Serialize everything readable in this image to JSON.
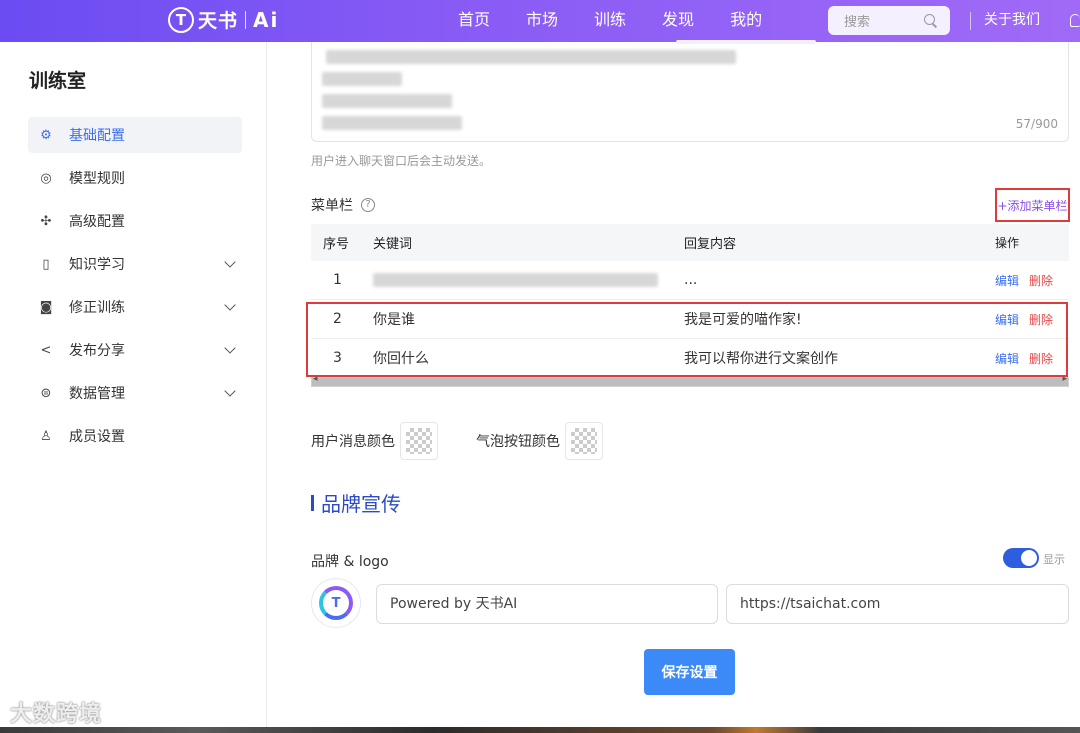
{
  "nav": {
    "logo_mark": "T",
    "logo_text": "天书",
    "logo_ai": "Ai",
    "items": [
      {
        "label": "首页"
      },
      {
        "label": "市场"
      },
      {
        "label": "训练"
      },
      {
        "label": "发现"
      },
      {
        "label": "我的"
      }
    ],
    "search_placeholder": "搜索",
    "about": "关于我们"
  },
  "sidebar": {
    "title": "训练室",
    "items": [
      {
        "label": "基础配置",
        "icon": "gear-icon",
        "active": true
      },
      {
        "label": "模型规则",
        "icon": "target-icon"
      },
      {
        "label": "高级配置",
        "icon": "puzzle-icon"
      },
      {
        "label": "知识学习",
        "icon": "book-icon",
        "expandable": true
      },
      {
        "label": "修正训练",
        "icon": "robot-icon",
        "expandable": true
      },
      {
        "label": "发布分享",
        "icon": "share-icon",
        "expandable": true
      },
      {
        "label": "数据管理",
        "icon": "list-icon",
        "expandable": true
      },
      {
        "label": "成员设置",
        "icon": "user-icon"
      }
    ]
  },
  "welcome": {
    "counter": "57/900",
    "hint": "用户进入聊天窗口后会主动发送。"
  },
  "menu_bar": {
    "title": "菜单栏",
    "add_label": "+添加菜单栏",
    "columns": [
      "序号",
      "关键词",
      "回复内容",
      "操作"
    ],
    "rows": [
      {
        "index": "1",
        "keyword": "",
        "reply": "...",
        "edit": "编辑",
        "delete": "删除"
      },
      {
        "index": "2",
        "keyword": "你是谁",
        "reply": "我是可爱的喵作家!",
        "edit": "编辑",
        "delete": "删除"
      },
      {
        "index": "3",
        "keyword": "你回什么",
        "reply": "我可以帮你进行文案创作",
        "edit": "编辑",
        "delete": "删除"
      }
    ]
  },
  "colors": {
    "user_msg_label": "用户消息颜色",
    "bubble_btn_label": "气泡按钮颜色"
  },
  "brand": {
    "section_title": "品牌宣传",
    "logo_label": "品牌 & logo",
    "toggle_label": "显示",
    "toggle_on": true,
    "logo_mark": "T",
    "powered_by": "Powered by 天书AI",
    "url": "https://tsaichat.com"
  },
  "save_label": "保存设置",
  "watermark": "大数跨境",
  "theme": {
    "accent": "#3a6df0",
    "nav_gradient_start": "#6b4cf2",
    "nav_gradient_end": "#a06af6",
    "highlight_border": "#e03b3b"
  }
}
